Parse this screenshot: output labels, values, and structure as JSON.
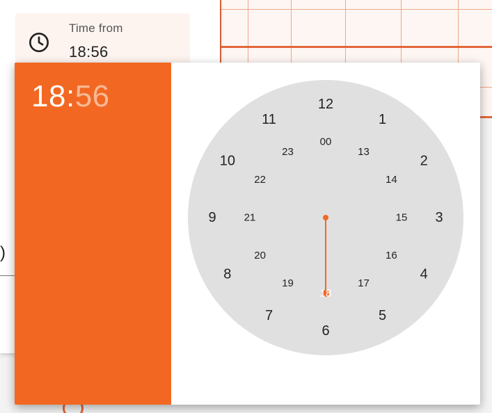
{
  "form": {
    "time_label": "Time from",
    "time_value": "18:56",
    "icon": "clock-icon",
    "paren_text": ")"
  },
  "picker": {
    "hours": "18",
    "separator": ":",
    "minutes": "56",
    "mode": "hours",
    "selected_hour": "18",
    "outer_ring": [
      "12",
      "1",
      "2",
      "3",
      "4",
      "5",
      "6",
      "7",
      "8",
      "9",
      "10",
      "11"
    ],
    "inner_ring": [
      "00",
      "13",
      "14",
      "15",
      "16",
      "17",
      "18",
      "19",
      "20",
      "21",
      "22",
      "23"
    ]
  },
  "colors": {
    "accent": "#f26822",
    "accent_light": "#f9b995",
    "clock_face": "#e0e0e0"
  }
}
